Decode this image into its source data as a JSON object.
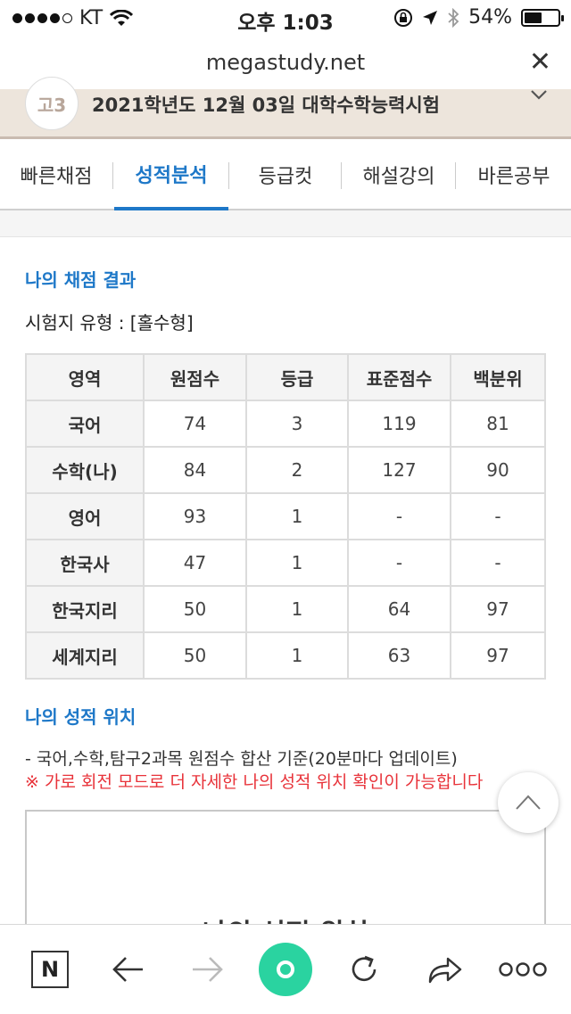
{
  "status_bar": {
    "carrier": "KT",
    "time": "오후 1:03",
    "battery": "54%",
    "battery_level": 0.54
  },
  "browser": {
    "url": "megastudy.net",
    "close_icon": "close-icon"
  },
  "exam_header": {
    "grade_badge": "고3",
    "title": "2021학년도 12월 03일 대학수학능력시험"
  },
  "tabs": [
    {
      "label": "빠른채점",
      "active": false
    },
    {
      "label": "성적분석",
      "active": true
    },
    {
      "label": "등급컷",
      "active": false
    },
    {
      "label": "해설강의",
      "active": false
    },
    {
      "label": "바른공부",
      "active": false
    }
  ],
  "result_section": {
    "title": "나의 채점 결과",
    "exam_type": "시험지 유형 : [홀수형]"
  },
  "score_table": {
    "headers": [
      "영역",
      "원점수",
      "등급",
      "표준점수",
      "백분위"
    ],
    "rows": [
      [
        "국어",
        "74",
        "3",
        "119",
        "81"
      ],
      [
        "수학(나)",
        "84",
        "2",
        "127",
        "90"
      ],
      [
        "영어",
        "93",
        "1",
        "-",
        "-"
      ],
      [
        "한국사",
        "47",
        "1",
        "-",
        "-"
      ],
      [
        "한국지리",
        "50",
        "1",
        "64",
        "97"
      ],
      [
        "세계지리",
        "50",
        "1",
        "63",
        "97"
      ]
    ]
  },
  "position_section": {
    "title": "나의 성적 위치",
    "note1": "- 국어,수학,탐구2과목 원점수 합산 기준(20분마다 업데이트)",
    "note2": "※ 가로 회전 모드로 더 자세한 나의 성적 위치 확인이 가능합니다",
    "chart_title": "나의 성적 위치"
  },
  "toolbar": {
    "home_label": "N"
  },
  "colors": {
    "accent": "#1e78c8",
    "warning": "#e8333a",
    "header_bg": "#ede5dc",
    "home_button": "#2ad3a0"
  }
}
